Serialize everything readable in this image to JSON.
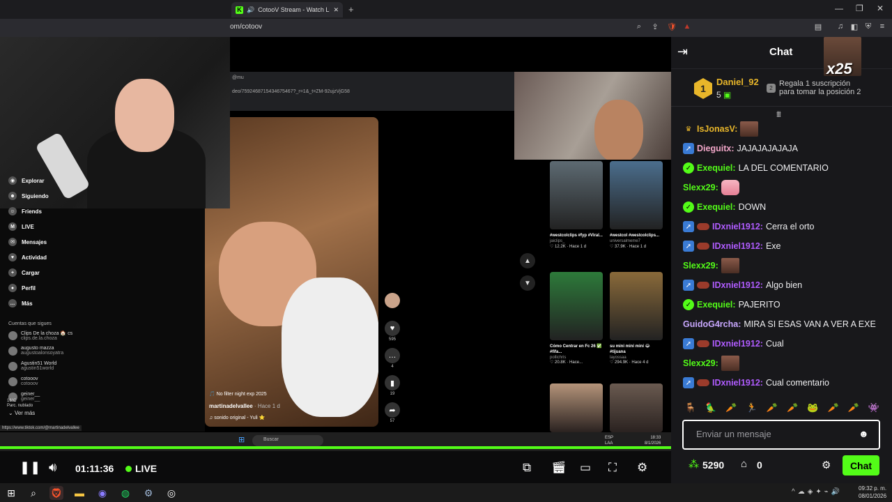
{
  "browser": {
    "tab_title": "CotooV Stream - Watch Live o",
    "url": "om/cotoov",
    "new_tab": "+",
    "min": "—",
    "max": "❐",
    "close": "✕"
  },
  "tiktok": {
    "tab_text": "@mu",
    "url": "deo/7592468715434675467?_r=1&_t=ZM-92ujzVjG58",
    "nav": [
      {
        "label": "Explorar",
        "icon": "compass-icon",
        "glyph": "◉"
      },
      {
        "label": "Siguiendo",
        "icon": "following-icon",
        "glyph": "☻"
      },
      {
        "label": "Friends",
        "icon": "friends-icon",
        "glyph": "☺"
      },
      {
        "label": "LIVE",
        "icon": "live-icon",
        "glyph": "M"
      },
      {
        "label": "Mensajes",
        "icon": "messages-icon",
        "glyph": "✉"
      },
      {
        "label": "Actividad",
        "icon": "activity-icon",
        "glyph": "♥"
      },
      {
        "label": "Cargar",
        "icon": "upload-icon",
        "glyph": "+"
      },
      {
        "label": "Perfil",
        "icon": "profile-icon",
        "glyph": "●"
      },
      {
        "label": "Más",
        "icon": "more-icon",
        "glyph": "…"
      }
    ],
    "follow_heading": "Cuentas que sigues",
    "following": [
      {
        "name": "Clips De la choza 🏠 cs",
        "handle": "clips.de.la.choza"
      },
      {
        "name": "augusto mazza",
        "handle": "augustoalonsoyatra"
      },
      {
        "name": "Agustin51 World",
        "handle": "agustin51world"
      },
      {
        "name": "cotooov",
        "handle": "cotooov"
      },
      {
        "name": "geiner__",
        "handle": "geiner__"
      }
    ],
    "see_more": "Ver más",
    "video_caption": "🎵 No filter night exp 2025",
    "video_author": "martinadelvallee",
    "video_time": " · Hace 1 d",
    "video_sound": "♫ sonido original - Yuli ⭐",
    "actions": [
      {
        "name": "like",
        "glyph": "♥",
        "count": "595"
      },
      {
        "name": "comment",
        "glyph": "…",
        "count": "4"
      },
      {
        "name": "save",
        "glyph": "▮",
        "count": "19"
      },
      {
        "name": "share",
        "glyph": "➦",
        "count": "57"
      }
    ],
    "thumbs": [
      {
        "title": "#westcolclips #fyp #Viral...",
        "user": "jaiclips_",
        "stats": "♡ 12.2K · Hace 1 d"
      },
      {
        "title": "#westcol #westcolclips...",
        "user": "universalmeme7",
        "stats": "♡ 37.9K · Hace 1 d"
      },
      {
        "title": "Cómo Centrar en Fc 26 ✅ #fifa...",
        "user": "pollichris",
        "stats": "♡ 20.8K · Hace..."
      },
      {
        "title": "su mini mini mini 😂 #tijuana",
        "user": "layossaa",
        "stats": "♡ 294.9K · Hace 4 d"
      }
    ],
    "status_url": "https://www.tiktok.com/@martinadelvallee"
  },
  "inner_taskbar": {
    "weather": "16°C",
    "weather_sub": "Parc. nublado",
    "search": "Buscar",
    "lang": "ESP",
    "lang_sub": "LAA",
    "time": "18:33",
    "date": "8/1/2026"
  },
  "player": {
    "time": "01:11:36",
    "live": "LIVE"
  },
  "chat": {
    "title": "Chat",
    "x25": "x25",
    "leader_rank": "1",
    "leader_name": "Daniel_92",
    "leader_count": "5",
    "gift_text_1": "Regala 1 suscripción",
    "gift_text_2": "para tomar la posición 2",
    "messages": [
      {
        "badge": "crown",
        "user": "IsJonasV",
        "color": "#e8b62a",
        "text": "",
        "emote": "emote"
      },
      {
        "badge": "blue",
        "user": "Dieguitx",
        "color": "#f2a7c9",
        "text": "JAJAJAJAJAJA",
        "emote": ""
      },
      {
        "badge": "verified",
        "user": "Exequiel",
        "color": "#53fc18",
        "text": "LA DEL COMENTARIO",
        "emote": ""
      },
      {
        "badge": "",
        "user": "Slexx29",
        "color": "#53fc18",
        "text": "",
        "emote": "emote-pink"
      },
      {
        "badge": "verified",
        "user": "Exequiel",
        "color": "#53fc18",
        "text": "DOWN",
        "emote": ""
      },
      {
        "badge": "blue-mini",
        "user": "IDxniel1912",
        "color": "#b05cff",
        "text": "Cerra el orto",
        "emote": ""
      },
      {
        "badge": "blue-mini",
        "user": "IDxniel1912",
        "color": "#b05cff",
        "text": "Exe",
        "emote": ""
      },
      {
        "badge": "",
        "user": "Slexx29",
        "color": "#53fc18",
        "text": "",
        "emote": "emote"
      },
      {
        "badge": "blue-mini",
        "user": "IDxniel1912",
        "color": "#b05cff",
        "text": "Algo bien",
        "emote": ""
      },
      {
        "badge": "verified",
        "user": "Exequiel",
        "color": "#53fc18",
        "text": "PAJERITO",
        "emote": ""
      },
      {
        "badge": "",
        "user": "GuidoG4rcha",
        "color": "#c9a8ff",
        "text": "MIRA SI ESAS VAN A VER A EXE",
        "emote": ""
      },
      {
        "badge": "blue-mini",
        "user": "IDxniel1912",
        "color": "#b05cff",
        "text": "Cual",
        "emote": ""
      },
      {
        "badge": "",
        "user": "Slexx29",
        "color": "#53fc18",
        "text": "",
        "emote": "emote"
      },
      {
        "badge": "blue-mini",
        "user": "IDxniel1912",
        "color": "#b05cff",
        "text": "Cual comentario",
        "emote": ""
      }
    ],
    "emote_bar": [
      "🪑",
      "🦜",
      "🥕",
      "🏃",
      "🥕",
      "🥕",
      "🐸",
      "🥕",
      "🥕",
      "👾"
    ],
    "input_placeholder": "Enviar un mensaje",
    "points": "5290",
    "store_count": "0",
    "send": "Chat"
  },
  "windows": {
    "clock_time": "09:32 p. m.",
    "clock_date": "08/01/2026",
    "apps": [
      "start-icon",
      "search-icon",
      "brave-icon",
      "files-icon",
      "discord-icon",
      "spotify-icon",
      "steam-icon",
      "obs-icon"
    ]
  },
  "colors": {
    "kick_green": "#53fc18",
    "chat_bg": "#18181b"
  }
}
